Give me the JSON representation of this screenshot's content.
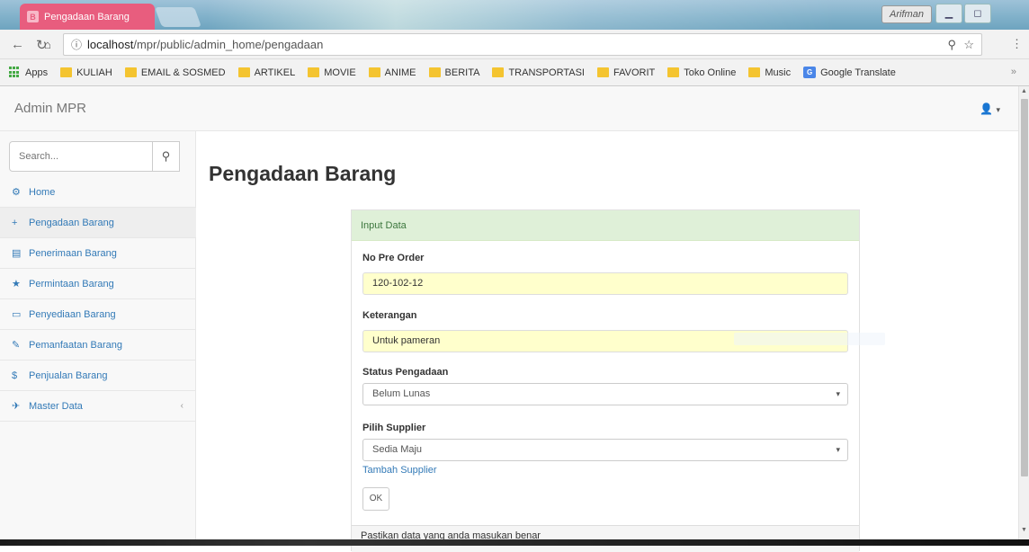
{
  "browser": {
    "tab_title": "Pengadaan Barang",
    "url_host": "localhost",
    "url_path": "/mpr/public/admin_home/pengadaan",
    "profile_name": "Arifman",
    "bookmarks": [
      {
        "label": "Apps",
        "icon": "apps-grid-icon"
      },
      {
        "label": "KULIAH",
        "icon": "folder-icon"
      },
      {
        "label": "EMAIL & SOSMED",
        "icon": "folder-icon"
      },
      {
        "label": "ARTIKEL",
        "icon": "folder-icon"
      },
      {
        "label": "MOVIE",
        "icon": "folder-icon"
      },
      {
        "label": "ANIME",
        "icon": "folder-icon"
      },
      {
        "label": "BERITA",
        "icon": "folder-icon"
      },
      {
        "label": "TRANSPORTASI",
        "icon": "folder-icon"
      },
      {
        "label": "FAVORIT",
        "icon": "folder-icon"
      },
      {
        "label": "Toko Online",
        "icon": "folder-icon"
      },
      {
        "label": "Music",
        "icon": "folder-icon"
      },
      {
        "label": "Google Translate",
        "icon": "google-translate-icon"
      }
    ],
    "bookmarks_more": "»"
  },
  "app": {
    "brand": "Admin MPR"
  },
  "sidebar": {
    "search_placeholder": "Search...",
    "items": [
      {
        "label": "Home",
        "icon": "dashboard-icon"
      },
      {
        "label": "Pengadaan Barang",
        "icon": "plus-icon",
        "active": true
      },
      {
        "label": "Penerimaan Barang",
        "icon": "list-icon"
      },
      {
        "label": "Permintaan Barang",
        "icon": "star-icon"
      },
      {
        "label": "Penyediaan Barang",
        "icon": "hdd-icon"
      },
      {
        "label": "Pemanfaatan Barang",
        "icon": "edit-icon"
      },
      {
        "label": "Penjualan Barang",
        "icon": "dollar-icon"
      },
      {
        "label": "Master Data",
        "icon": "wrench-icon",
        "has_submenu": true
      }
    ]
  },
  "main": {
    "page_title": "Pengadaan Barang",
    "panel": {
      "heading": "Input Data",
      "fields": {
        "no_pre_order": {
          "label": "No Pre Order",
          "value": "120-102-12"
        },
        "keterangan": {
          "label": "Keterangan",
          "value": "Untuk pameran"
        },
        "status_pengadaan": {
          "label": "Status Pengadaan",
          "value": "Belum Lunas"
        },
        "supplier": {
          "label": "Pilih Supplier",
          "value": "Sedia Maju"
        }
      },
      "add_supplier_link": "Tambah Supplier",
      "submit_label": "OK",
      "footer_text": "Pastikan data yang anda masukan benar"
    }
  },
  "colors": {
    "tab": "#e85d7e",
    "link": "#337ab7",
    "panel_head_bg": "#dff0d8",
    "filled_input_bg": "#ffffcc"
  }
}
